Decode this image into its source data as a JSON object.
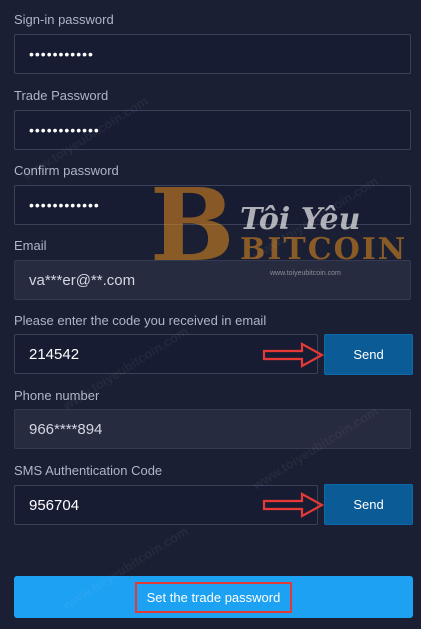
{
  "form": {
    "signin": {
      "label": "Sign-in password",
      "value": "•••••••••••"
    },
    "trade": {
      "label": "Trade Password",
      "value": "••••••••••••"
    },
    "confirm": {
      "label": "Confirm password",
      "value": "••••••••••••"
    },
    "email": {
      "label": "Email",
      "value": "va***er@**.com"
    },
    "email_code": {
      "label": "Please enter the code you received in email",
      "value": "214542",
      "send_label": "Send"
    },
    "phone": {
      "label": "Phone number",
      "value": "966****894"
    },
    "sms_code": {
      "label": "SMS Authentication Code",
      "value": "956704",
      "send_label": "Send"
    },
    "submit_label": "Set the trade password"
  },
  "watermark": {
    "logo_letter": "B",
    "logo_title": "Tôi Yêu",
    "logo_bitcoin": "BITCOIN",
    "logo_url": "www.toiyeubitcoin.com",
    "repeat_text": "www.toiyeubitcoin.com"
  },
  "colors": {
    "background": "#1a1f33",
    "input_bg": "#181c33",
    "readonly_bg": "#272b3f",
    "send_button": "#0b5b97",
    "primary_button": "#1da1f2",
    "annotation_red": "#e53935",
    "logo_orange": "#e68c1e"
  },
  "icons": {
    "annotation_arrow": "red-outline-arrow-right"
  }
}
